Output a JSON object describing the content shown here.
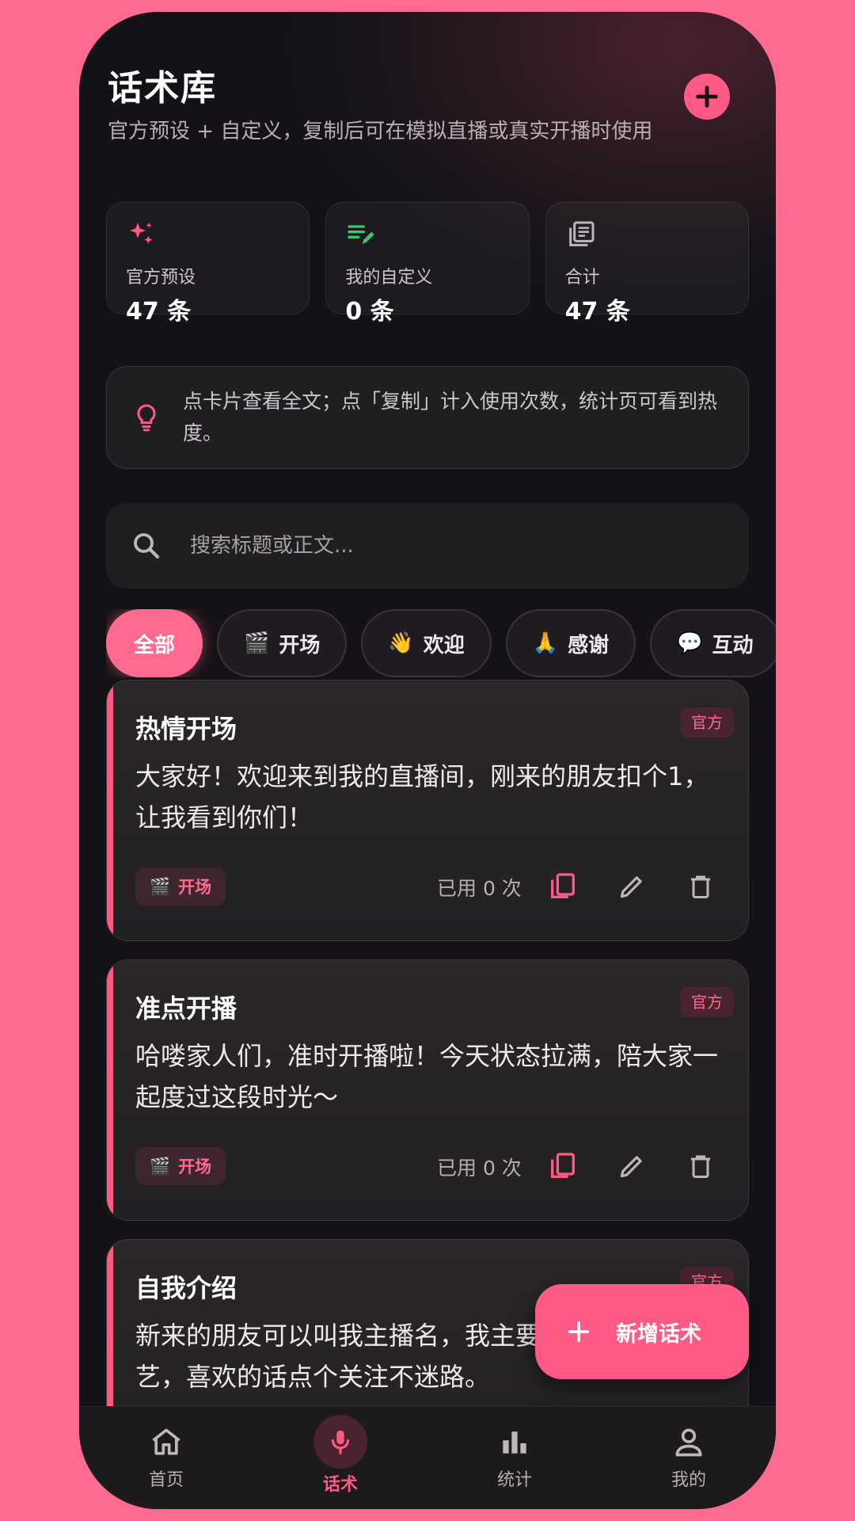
{
  "header": {
    "title": "话术库",
    "subtitle": "官方预设 + 自定义，复制后可在模拟直播或真实开播时使用"
  },
  "stats": [
    {
      "label": "官方预设",
      "value": "47 条",
      "icon": "sparkle-icon"
    },
    {
      "label": "我的自定义",
      "value": "0 条",
      "icon": "edit-list-icon"
    },
    {
      "label": "合计",
      "value": "47 条",
      "icon": "library-icon"
    }
  ],
  "tip": {
    "text": "点卡片查看全文；点「复制」计入使用次数，统计页可看到热度。"
  },
  "search": {
    "placeholder": "搜索标题或正文..."
  },
  "chips": [
    {
      "emoji": "",
      "label": "全部",
      "active": true
    },
    {
      "emoji": "🎬",
      "label": "开场"
    },
    {
      "emoji": "👋",
      "label": "欢迎"
    },
    {
      "emoji": "🙏",
      "label": "感谢"
    },
    {
      "emoji": "💬",
      "label": "互动"
    }
  ],
  "cards": [
    {
      "title": "热情开场",
      "badge": "官方",
      "body": "大家好！欢迎来到我的直播间，刚来的朋友扣个1，让我看到你们！",
      "tag_emoji": "🎬",
      "tag": "开场",
      "used": "已用 0 次"
    },
    {
      "title": "准点开播",
      "badge": "官方",
      "body": "哈喽家人们，准时开播啦！今天状态拉满，陪大家一起度过这段时光～",
      "tag_emoji": "🎬",
      "tag": "开场",
      "used": "已用 0 次"
    },
    {
      "title": "自我介绍",
      "badge": "官方",
      "body": "新来的朋友可以叫我主播名，我主要分享好物/才艺，喜欢的话点个关注不迷路。",
      "tag_emoji": "",
      "tag": "",
      "used": ""
    }
  ],
  "fab": {
    "label": "新增话术"
  },
  "nav": [
    {
      "label": "首页",
      "icon": "home-icon"
    },
    {
      "label": "话术",
      "icon": "mic-icon",
      "active": true
    },
    {
      "label": "统计",
      "icon": "bar-chart-icon"
    },
    {
      "label": "我的",
      "icon": "profile-icon"
    }
  ],
  "colors": {
    "accent": "#ff5a86",
    "background": "#17141a",
    "outer": "#ff6b8e"
  }
}
